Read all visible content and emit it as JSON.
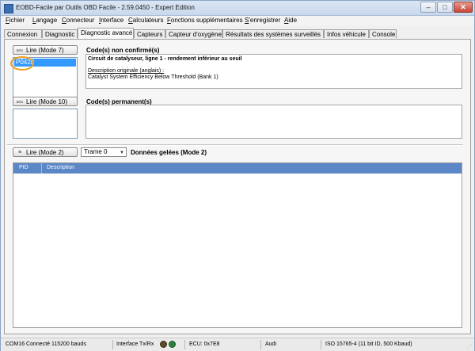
{
  "window": {
    "title": "EOBD-Facile par Outils OBD Facile - 2.59.0450 - Expert Edition",
    "controls": {
      "minimize": "–",
      "maximize": "□",
      "close": "✕"
    }
  },
  "menu": [
    {
      "accel": "F",
      "rest": "ichier"
    },
    {
      "accel": "L",
      "rest": "angage"
    },
    {
      "accel": "C",
      "rest": "onnecteur"
    },
    {
      "accel": "I",
      "rest": "nterface"
    },
    {
      "accel": "C",
      "rest": "alculateurs"
    },
    {
      "accel": "F",
      "rest": "onctions supplémentaires"
    },
    {
      "accel": "S",
      "rest": "'enregistrer"
    },
    {
      "accel": "A",
      "rest": "ide"
    }
  ],
  "tabs": [
    {
      "label": "Connexion"
    },
    {
      "label": "Diagnostic"
    },
    {
      "label": "Diagnostic avancé",
      "active": true
    },
    {
      "label": "Capteurs"
    },
    {
      "label": "Capteur d'oxygène"
    },
    {
      "label": "Résultats des systèmes surveillés"
    },
    {
      "label": "Infos véhicule"
    },
    {
      "label": "Console"
    }
  ],
  "pending": {
    "button_label": "Lire (Mode 7)",
    "button_icon": "DTC",
    "title": "Code(s) non confirmé(s)",
    "codes": [
      "P0420"
    ],
    "desc_title": "Circuit de catalyseur, ligne 1 - rendement inférieur au seuil",
    "desc_orig_label": "Description originale (anglais) :",
    "desc_orig": "Catalyst System Efficiency Below Threshold (Bank 1)"
  },
  "permanent": {
    "button_label": "Lire (Mode 10)",
    "button_icon": "DTC",
    "title": "Code(s) permanent(s)"
  },
  "freeze": {
    "button_label": "Lire (Mode 2)",
    "frame_value": "Trame 0",
    "title": "Données gelées (Mode 2)",
    "columns": [
      "PID",
      "Description"
    ]
  },
  "status": {
    "connection": "COM16 Connecté 115200 bauds",
    "interface": "Interface Tx/Rx",
    "ecu": "ECU: 0x7E8",
    "make": "Audi",
    "protocol": "ISO 15765-4 (11 bit ID, 500 Kbaud)"
  },
  "colors": {
    "selection": "#3399ff",
    "grid_header": "#5b87c6",
    "highlight": "#f0a020",
    "led_rx": "#2a7f3b"
  }
}
